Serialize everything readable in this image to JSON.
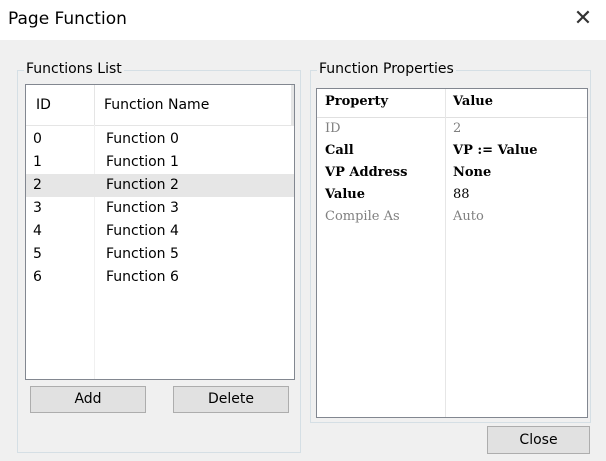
{
  "window": {
    "title": "Page Function",
    "close_glyph": "✕"
  },
  "functions_list": {
    "label": "Functions List",
    "columns": [
      "ID",
      "Function Name"
    ],
    "rows": [
      {
        "id": "0",
        "name": "Function 0"
      },
      {
        "id": "1",
        "name": "Function 1"
      },
      {
        "id": "2",
        "name": "Function 2",
        "selected": true
      },
      {
        "id": "3",
        "name": "Function 3"
      },
      {
        "id": "4",
        "name": "Function 4"
      },
      {
        "id": "5",
        "name": "Function 5"
      },
      {
        "id": "6",
        "name": "Function 6"
      }
    ]
  },
  "buttons": {
    "add": "Add",
    "delete": "Delete",
    "close": "Close"
  },
  "function_properties": {
    "label": "Function Properties",
    "columns": [
      "Property",
      "Value"
    ],
    "rows": [
      {
        "property": "ID",
        "value": "2",
        "state": "readonly"
      },
      {
        "property": "Call",
        "value": "VP := Value",
        "state": "editable"
      },
      {
        "property": "VP Address",
        "value": "None",
        "state": "editable"
      },
      {
        "property": "Value",
        "value": "88",
        "state": "editable"
      },
      {
        "property": "Compile As",
        "value": "Auto",
        "state": "readonly"
      }
    ]
  },
  "colors": {
    "selected_row": "#e6e6e6",
    "readonly_text": "#808080",
    "button_face": "#e1e1e1"
  }
}
